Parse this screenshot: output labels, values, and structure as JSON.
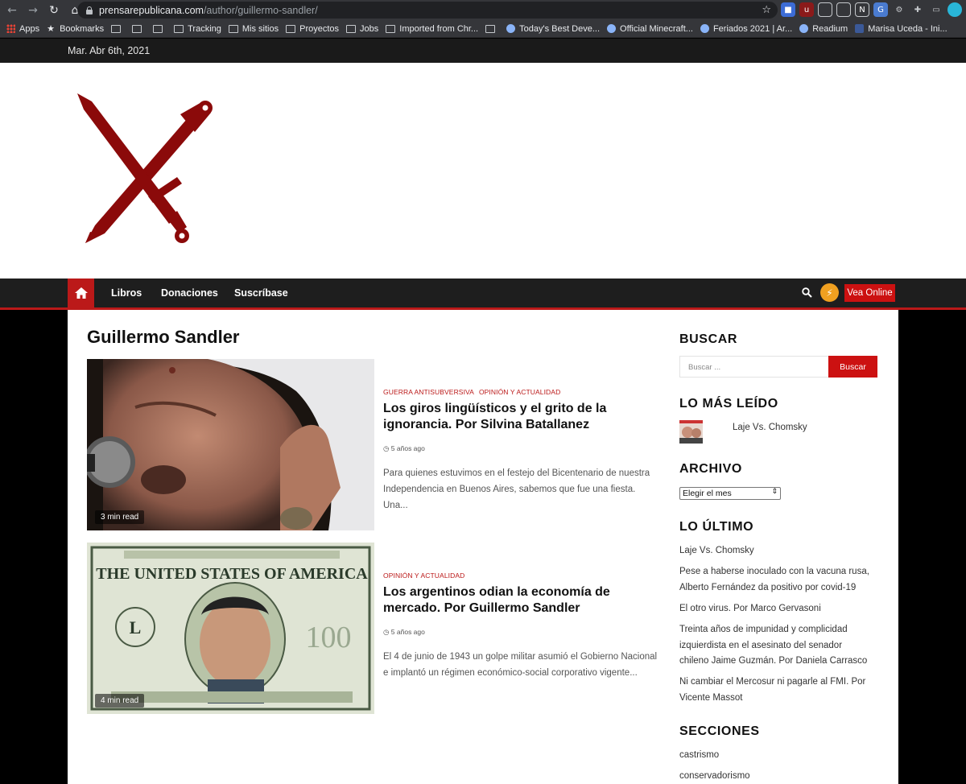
{
  "browser": {
    "url_host": "prensarepublicana.com",
    "url_path": "/author/guillermo-sandler/",
    "bookmarks": [
      {
        "label": "Apps",
        "icon": "apps-grid-icon"
      },
      {
        "label": "Bookmarks",
        "icon": "star-icon"
      },
      {
        "label": "",
        "icon": "folder-icon"
      },
      {
        "label": "",
        "icon": "folder-icon"
      },
      {
        "label": "",
        "icon": "folder-icon"
      },
      {
        "label": "Tracking",
        "icon": "folder-icon"
      },
      {
        "label": "Mis sitios",
        "icon": "folder-icon"
      },
      {
        "label": "Proyectos",
        "icon": "folder-icon"
      },
      {
        "label": "Jobs",
        "icon": "folder-icon"
      },
      {
        "label": "Imported from Chr...",
        "icon": "folder-icon"
      },
      {
        "label": "",
        "icon": "folder-icon"
      },
      {
        "label": "Today's Best Deve...",
        "icon": "site-icon"
      },
      {
        "label": "Official Minecraft...",
        "icon": "site-icon"
      },
      {
        "label": "Feriados 2021 | Ar...",
        "icon": "site-icon"
      },
      {
        "label": "Readium",
        "icon": "site-icon"
      },
      {
        "label": "Marisa Uceda - Ini...",
        "icon": "facebook-icon"
      }
    ]
  },
  "topbar": {
    "date": "Mar. Abr 6th, 2021"
  },
  "nav": {
    "items": [
      "Libros",
      "Donaciones",
      "Suscríbase"
    ],
    "vea_online": "Vea Online"
  },
  "page": {
    "title": "Guillermo Sandler"
  },
  "posts": [
    {
      "categories": [
        "Guerra antisubversiva",
        "Opinión y actualidad"
      ],
      "title": "Los giros lingüísticos y el grito de la ignorancia. Por Silvina Batallanez",
      "date": "5 años ago",
      "excerpt": "Para quienes estuvimos en el festejo del Bicentenario de nuestra Independencia en Buenos Aires, sabemos que fue una fiesta. Una...",
      "read_time": "3 min read"
    },
    {
      "categories": [
        "Opinión y actualidad"
      ],
      "title": "Los argentinos odian la economía de mercado. Por Guillermo Sandler",
      "date": "5 años ago",
      "excerpt": "El 4 de junio de 1943 un golpe militar asumió el Gobierno Nacional e implantó un régimen económico-social corporativo vigente...",
      "read_time": "4 min read",
      "image_text": "THE UNITED STATES OF AMERICA"
    }
  ],
  "sidebar": {
    "buscar": {
      "heading": "BUSCAR",
      "placeholder": "Buscar ...",
      "button": "Buscar"
    },
    "mas_leido": {
      "heading": "LO MÁS LEÍDO",
      "items": [
        "Laje Vs. Chomsky"
      ]
    },
    "archivo": {
      "heading": "ARCHIVO",
      "select_value": "Elegir el mes"
    },
    "ultimo": {
      "heading": "LO ÚLTIMO",
      "items": [
        "Laje Vs. Chomsky",
        "Pese a haberse inoculado con la vacuna rusa, Alberto Fernández da positivo por covid-19",
        "El otro virus. Por Marco Gervasoni",
        "Treinta años de impunidad y complicidad izquierdista en el asesinato del senador chileno Jaime Guzmán. Por Daniela Carrasco",
        "Ni cambiar el Mercosur ni pagarle al FMI. Por Vicente Massot"
      ]
    },
    "secciones": {
      "heading": "SECCIONES",
      "items": [
        "castrismo",
        "conservadorismo"
      ]
    }
  },
  "colors": {
    "accent": "#bb1919",
    "nav_bg": "#1e1e1e",
    "logo": "#8b0a0a"
  }
}
